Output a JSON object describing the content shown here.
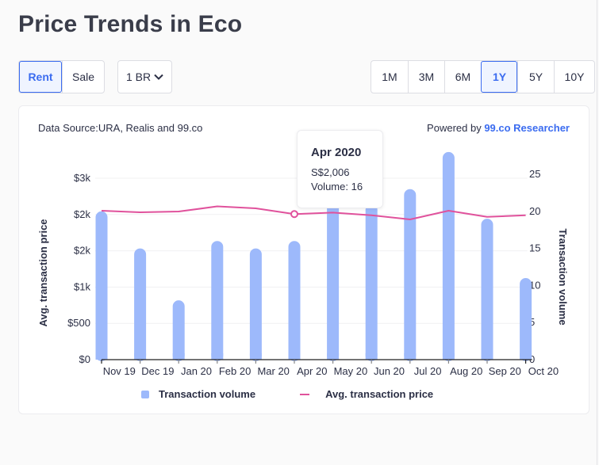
{
  "page": {
    "title": "Price Trends in Eco"
  },
  "controls": {
    "type_options": [
      {
        "label": "Rent",
        "active": true
      },
      {
        "label": "Sale",
        "active": false
      }
    ],
    "bedroom_select": {
      "value": "1 BR",
      "icon": "chevron-down-icon"
    },
    "range_options": [
      {
        "label": "1M",
        "active": false
      },
      {
        "label": "3M",
        "active": false
      },
      {
        "label": "6M",
        "active": false
      },
      {
        "label": "1Y",
        "active": true
      },
      {
        "label": "5Y",
        "active": false
      },
      {
        "label": "10Y",
        "active": false
      }
    ]
  },
  "card": {
    "source": "Data Source:URA, Realis and 99.co",
    "powered_prefix": "Powered by ",
    "powered_brand": "99.co Researcher"
  },
  "tooltip": {
    "title": "Apr 2020",
    "price": "S$2,006",
    "volume": "Volume: 16"
  },
  "colors": {
    "bar": "#9db9fb",
    "line": "#e0529c",
    "accent": "#3b6cf0",
    "text": "#2b2f45",
    "grid": "#f0f0f2"
  },
  "chart_data": {
    "type": "bar",
    "title": "",
    "categories": [
      "Nov 19",
      "Dec 19",
      "Jan 20",
      "Feb 20",
      "Mar 20",
      "Apr 20",
      "May 20",
      "Jun 20",
      "Jul 20",
      "Aug 20",
      "Sep 20",
      "Oct 20"
    ],
    "series": [
      {
        "name": "Transaction volume",
        "type": "bar",
        "axis": "right",
        "values": [
          20,
          15,
          8,
          16,
          15,
          16,
          23,
          21,
          23,
          28,
          19,
          11
        ]
      },
      {
        "name": "Avg. transaction price",
        "type": "line",
        "axis": "left",
        "values": [
          2052,
          2031,
          2041,
          2112,
          2085,
          2006,
          2027,
          1990,
          1932,
          2052,
          1968,
          1990
        ]
      }
    ],
    "ylabel": "Avg. transaction price",
    "y2label": "Transaction volume",
    "ylim": [
      0,
      2500
    ],
    "y2lim": [
      0,
      25
    ],
    "yticks": [
      0,
      500,
      1000,
      1500,
      2000,
      2500
    ],
    "ytick_labels": [
      "$0",
      "$500",
      "$1k",
      "$2k",
      "$2k",
      "$3k"
    ],
    "y2ticks": [
      0,
      5,
      10,
      15,
      20,
      25
    ],
    "y2tick_labels": [
      "0",
      "5",
      "10",
      "15",
      "20",
      "25"
    ],
    "highlighted_index": 5,
    "grid": true,
    "legend": "bottom-center"
  }
}
